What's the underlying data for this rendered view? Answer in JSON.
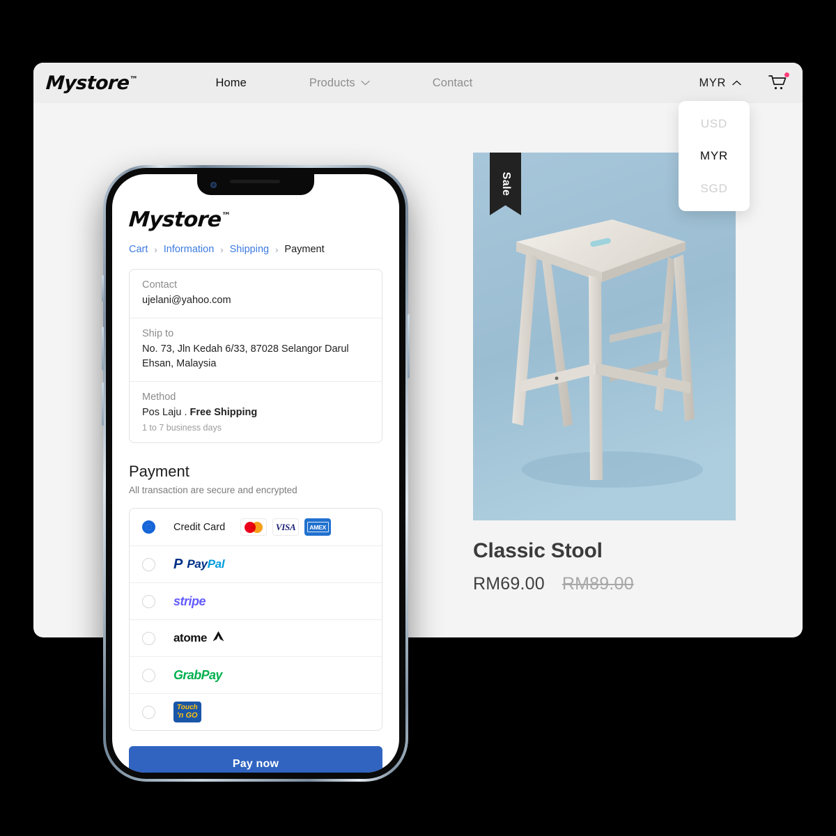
{
  "storefront": {
    "brand": "Mystore",
    "brand_tm": "™",
    "nav": [
      {
        "label": "Home",
        "active": true,
        "has_caret": false
      },
      {
        "label": "Products",
        "active": false,
        "has_caret": true
      },
      {
        "label": "Contact",
        "active": false,
        "has_caret": false
      }
    ],
    "currency_selected": "MYR",
    "currency_options": [
      "USD",
      "MYR",
      "SGD"
    ],
    "cart_icon": "shopping-cart-icon",
    "cart_has_badge": true,
    "badge_color": "#ff3e79"
  },
  "product": {
    "sale_badge": "Sale",
    "title": "Classic Stool",
    "price_current": "RM69.00",
    "price_original": "RM89.00",
    "image_alt": "whitewashed wooden bar stool on light blue background"
  },
  "checkout": {
    "brand": "Mystore",
    "brand_tm": "™",
    "breadcrumb": [
      {
        "label": "Cart",
        "current": false
      },
      {
        "label": "Information",
        "current": false
      },
      {
        "label": "Shipping",
        "current": false
      },
      {
        "label": "Payment",
        "current": true
      }
    ],
    "breadcrumb_separator": "›",
    "summary": {
      "contact_label": "Contact",
      "contact_value": "ujelani@yahoo.com",
      "ship_label": "Ship to",
      "ship_value": "No. 73, Jln Kedah 6/33, 87028 Selangor Darul Ehsan, Malaysia",
      "method_label": "Method",
      "method_carrier": "Pos Laju .",
      "method_price": "Free Shipping",
      "method_eta": "1 to 7 business days"
    },
    "payment_heading": "Payment",
    "payment_subheading": "All transaction are secure and encrypted",
    "methods": [
      {
        "id": "credit-card",
        "label": "Credit Card",
        "selected": true,
        "cards": [
          "mastercard",
          "visa",
          "amex"
        ]
      },
      {
        "id": "paypal",
        "label": "PayPal",
        "selected": false,
        "logo_part_a": "Pay",
        "logo_part_b": "Pal"
      },
      {
        "id": "stripe",
        "label": "stripe",
        "selected": false
      },
      {
        "id": "atome",
        "label": "atome",
        "selected": false
      },
      {
        "id": "grabpay",
        "label": "GrabPay",
        "selected": false
      },
      {
        "id": "touch-n-go",
        "label": "Touch 'n Go",
        "selected": false,
        "logo_line1": "Touch",
        "logo_line2": "'n GO"
      },
      {
        "id": "visa-text",
        "label": "VISA"
      },
      {
        "id": "amex-text",
        "label": "AMEX"
      }
    ],
    "pay_button": "Pay now"
  },
  "colors": {
    "page_background": "#000000",
    "card_background": "#f4f4f4",
    "topbar_background": "#ededed",
    "accent_blue": "#3064c0",
    "link_blue": "#3d7be0",
    "radio_blue": "#1565d8",
    "product_bg_blue": "#a3c3d8",
    "sale_ribbon": "#222222",
    "stripe_purple": "#635bff",
    "grab_green": "#00b14f",
    "tng_blue": "#1a56a8",
    "tng_yellow": "#ffc20e"
  }
}
